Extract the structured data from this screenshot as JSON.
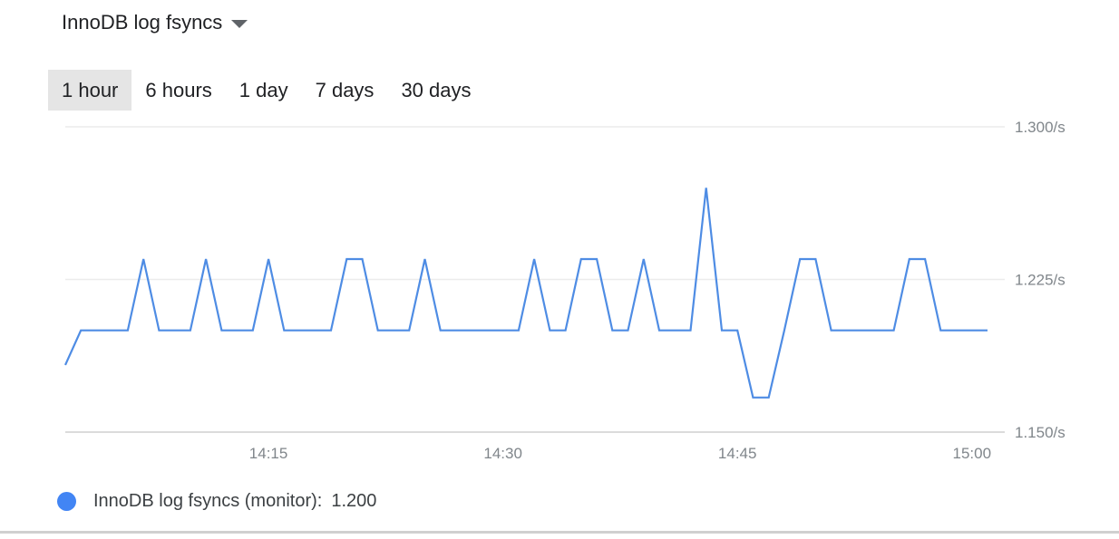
{
  "header": {
    "title": "InnoDB log fsyncs"
  },
  "time_ranges": [
    {
      "label": "1 hour",
      "active": true
    },
    {
      "label": "6 hours",
      "active": false
    },
    {
      "label": "1 day",
      "active": false
    },
    {
      "label": "7 days",
      "active": false
    },
    {
      "label": "30 days",
      "active": false
    }
  ],
  "chart_data": {
    "type": "line",
    "title": "",
    "xlabel": "",
    "ylabel": "",
    "x_unit": "minutes",
    "xlim": [
      "14:02",
      "15:01"
    ],
    "ylim": [
      1.15,
      1.3
    ],
    "yticks": [
      {
        "value": 1.3,
        "label": "1.300/s"
      },
      {
        "value": 1.225,
        "label": "1.225/s"
      },
      {
        "value": 1.15,
        "label": "1.150/s"
      }
    ],
    "xticks": [
      "14:15",
      "14:30",
      "14:45",
      "15:00"
    ],
    "grid": true,
    "series": [
      {
        "name": "InnoDB log fsyncs (monitor)",
        "color": "#4e8ce4",
        "x": [
          "14:02",
          "14:03",
          "14:04",
          "14:05",
          "14:06",
          "14:07",
          "14:08",
          "14:09",
          "14:10",
          "14:11",
          "14:12",
          "14:13",
          "14:14",
          "14:15",
          "14:16",
          "14:17",
          "14:18",
          "14:19",
          "14:20",
          "14:21",
          "14:22",
          "14:23",
          "14:24",
          "14:25",
          "14:26",
          "14:27",
          "14:28",
          "14:29",
          "14:30",
          "14:31",
          "14:32",
          "14:33",
          "14:34",
          "14:35",
          "14:36",
          "14:37",
          "14:38",
          "14:39",
          "14:40",
          "14:41",
          "14:42",
          "14:43",
          "14:44",
          "14:45",
          "14:46",
          "14:47",
          "14:48",
          "14:49",
          "14:50",
          "14:51",
          "14:52",
          "14:53",
          "14:54",
          "14:55",
          "14:56",
          "14:57",
          "14:58",
          "14:59",
          "15:00",
          "15:01"
        ],
        "values": [
          1.183,
          1.2,
          1.2,
          1.2,
          1.2,
          1.235,
          1.2,
          1.2,
          1.2,
          1.235,
          1.2,
          1.2,
          1.2,
          1.235,
          1.2,
          1.2,
          1.2,
          1.2,
          1.235,
          1.235,
          1.2,
          1.2,
          1.2,
          1.235,
          1.2,
          1.2,
          1.2,
          1.2,
          1.2,
          1.2,
          1.235,
          1.2,
          1.2,
          1.235,
          1.235,
          1.2,
          1.2,
          1.235,
          1.2,
          1.2,
          1.2,
          1.27,
          1.2,
          1.2,
          1.167,
          1.167,
          1.2,
          1.235,
          1.235,
          1.2,
          1.2,
          1.2,
          1.2,
          1.2,
          1.235,
          1.235,
          1.2,
          1.2,
          1.2,
          1.2
        ]
      }
    ]
  },
  "legend": {
    "label": "InnoDB log fsyncs (monitor):",
    "value": "1.200",
    "color": "#4285f4"
  }
}
